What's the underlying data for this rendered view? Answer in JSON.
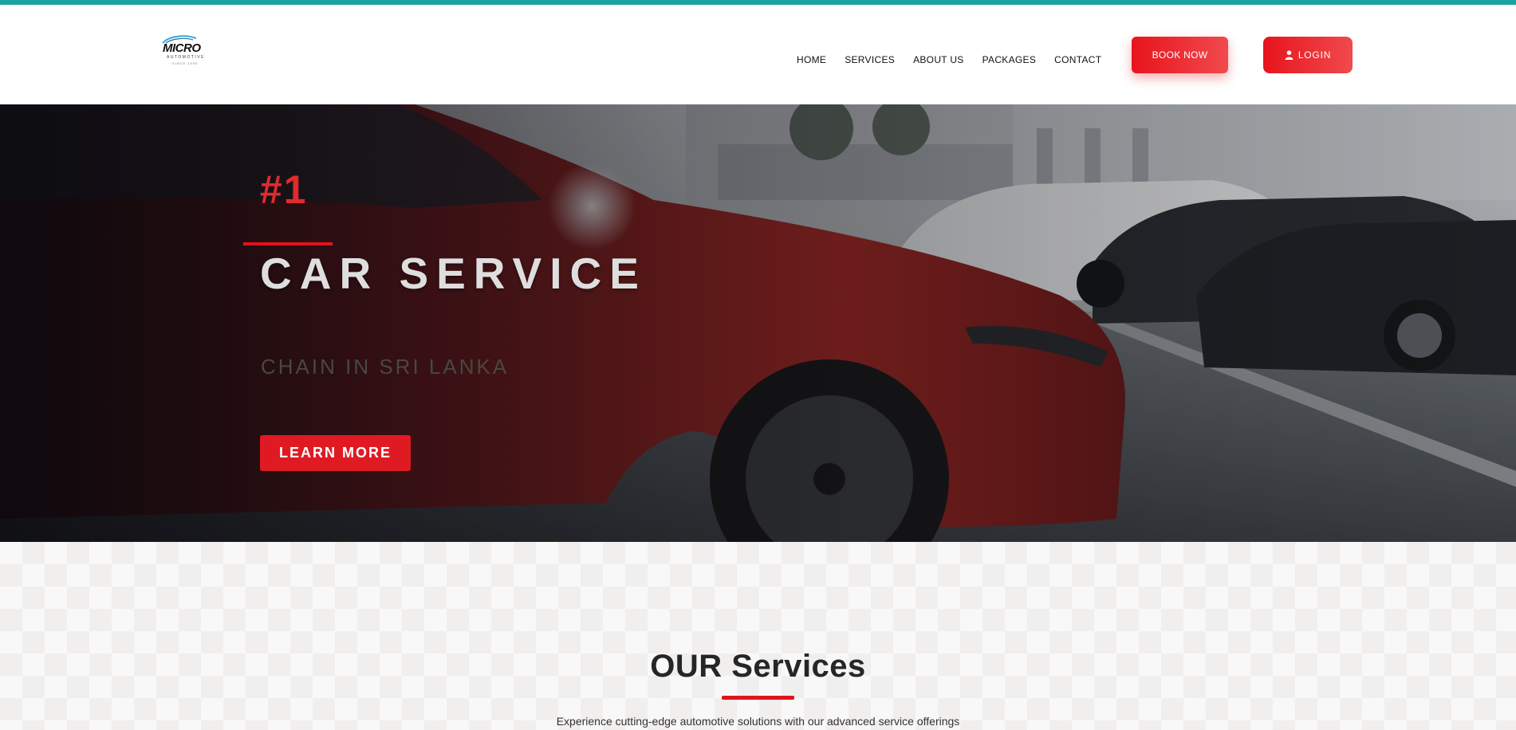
{
  "header": {
    "logo": {
      "brand": "MICRO",
      "sub": "AUTOMOTIVE",
      "tag": "SINCE 1990"
    },
    "nav": [
      {
        "label": "HOME"
      },
      {
        "label": "SERVICES"
      },
      {
        "label": "ABOUT US"
      },
      {
        "label": "PACKAGES"
      },
      {
        "label": "CONTACT"
      }
    ],
    "book_label": "BOOK NOW",
    "login_label": "LOGIN",
    "login_icon": "user-icon"
  },
  "hero": {
    "number": "#1",
    "title": "CAR SERVICE",
    "subtitle": "CHAIN IN SRI LANKA",
    "cta_label": "LEARN MORE"
  },
  "services": {
    "title": "OUR Services",
    "description": "Experience cutting-edge automotive solutions with our advanced service offerings"
  },
  "colors": {
    "accent": "#e0141c",
    "top_bar": "#1aa3a3",
    "text_dark": "#262626"
  }
}
